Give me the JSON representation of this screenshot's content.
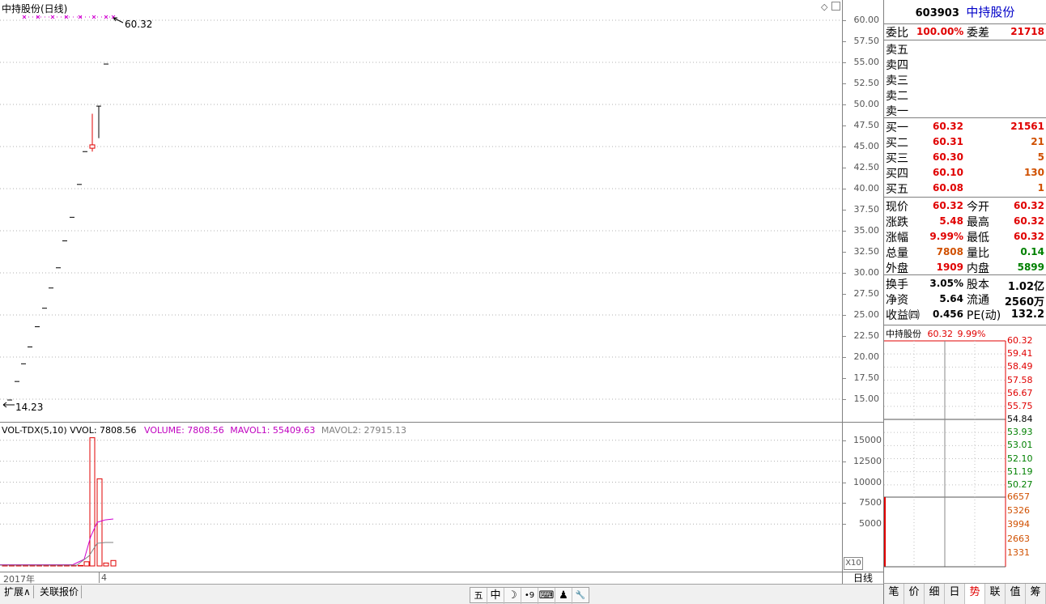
{
  "main_chart": {
    "title": "中持股份(日线)",
    "high_label": "60.32",
    "low_label": "14.23",
    "y_ticks": [
      "60.00",
      "57.50",
      "55.00",
      "52.50",
      "50.00",
      "47.50",
      "45.00",
      "42.50",
      "40.00",
      "37.50",
      "35.00",
      "32.50",
      "30.00",
      "27.50",
      "25.00",
      "22.50",
      "20.00",
      "17.50",
      "15.00"
    ]
  },
  "volume_chart": {
    "indicator": "VOL-TDX(5,10)",
    "vvol": "VVOL: 7808.56",
    "volume": "VOLUME: 7808.56",
    "mavol1": "MAVOL1: 55409.63",
    "mavol2": "MAVOL2: 27915.13",
    "y_ticks": [
      "15000",
      "12500",
      "10000",
      "7500",
      "5000"
    ],
    "multiplier": "X10"
  },
  "date_axis": {
    "year": "2017年",
    "month": "4"
  },
  "period": "日线",
  "bottom_tabs": [
    "扩展∧",
    "关联报价"
  ],
  "toolbar_icons": [
    "五",
    "中",
    "☽",
    "•9",
    "⌨",
    "♟",
    "🔧"
  ],
  "quote": {
    "code": "603903",
    "name": "中持股份",
    "weibi_label": "委比",
    "weibi": "100.00%",
    "weicha_label": "委差",
    "weicha": "21718",
    "sells": [
      {
        "label": "卖五"
      },
      {
        "label": "卖四"
      },
      {
        "label": "卖三"
      },
      {
        "label": "卖二"
      },
      {
        "label": "卖一"
      }
    ],
    "buys": [
      {
        "label": "买一",
        "price": "60.32",
        "vol": "21561"
      },
      {
        "label": "买二",
        "price": "60.31",
        "vol": "21"
      },
      {
        "label": "买三",
        "price": "60.30",
        "vol": "5"
      },
      {
        "label": "买四",
        "price": "60.10",
        "vol": "130"
      },
      {
        "label": "买五",
        "price": "60.08",
        "vol": "1"
      }
    ],
    "stats": [
      {
        "l1": "现价",
        "v1": "60.32",
        "l2": "今开",
        "v2": "60.32"
      },
      {
        "l1": "涨跌",
        "v1": "5.48",
        "l2": "最高",
        "v2": "60.32"
      },
      {
        "l1": "涨幅",
        "v1": "9.99%",
        "l2": "最低",
        "v2": "60.32"
      },
      {
        "l1": "总量",
        "v1": "7808",
        "l2": "量比",
        "v2": "0.14"
      },
      {
        "l1": "外盘",
        "v1": "1909",
        "l2": "内盘",
        "v2": "5899"
      }
    ],
    "fund": [
      {
        "l1": "换手",
        "v1": "3.05%",
        "l2": "股本",
        "v2": "1.02亿"
      },
      {
        "l1": "净资",
        "v1": "5.64",
        "l2": "流通",
        "v2": "2560万"
      },
      {
        "l1": "收益㈣",
        "v1": "0.456",
        "l2": "PE(动)",
        "v2": "132.2"
      }
    ]
  },
  "mini_chart": {
    "name": "中持股份",
    "price": "60.32",
    "pct": "9.99%",
    "price_ticks": [
      "60.32",
      "59.41",
      "58.49",
      "57.58",
      "56.67",
      "55.75",
      "54.84",
      "53.93",
      "53.01",
      "52.10",
      "51.19",
      "50.27"
    ],
    "vol_ticks": [
      "6657",
      "5326",
      "3994",
      "2663",
      "1331"
    ]
  },
  "right_tabs": [
    "笔",
    "价",
    "细",
    "日",
    "势",
    "联",
    "值",
    "筹"
  ],
  "active_right_tab": "势"
}
